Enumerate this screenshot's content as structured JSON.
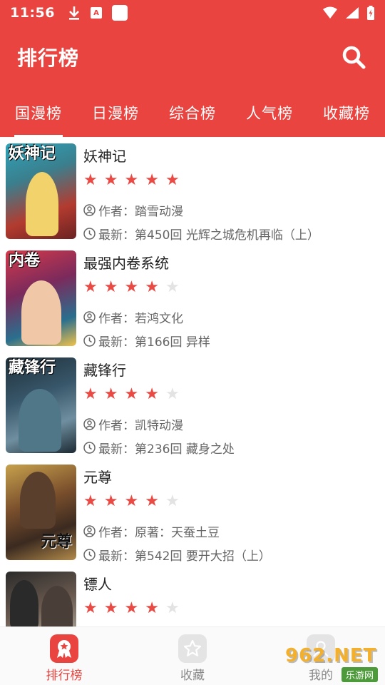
{
  "status_bar": {
    "time": "11:56",
    "badge_letter": "A"
  },
  "app_bar": {
    "title": "排行榜",
    "search_icon": "search-icon"
  },
  "tabs": [
    {
      "label": "国漫榜",
      "active": true
    },
    {
      "label": "日漫榜",
      "active": false
    },
    {
      "label": "综合榜",
      "active": false
    },
    {
      "label": "人气榜",
      "active": false
    },
    {
      "label": "收藏榜",
      "active": false
    }
  ],
  "list": {
    "items": [
      {
        "title": "妖神记",
        "rating": 5,
        "author_label": "作者：踏雪动漫",
        "latest_label": "最新：第450回 光辉之城危机再临（上）",
        "cover_text": "妖神记"
      },
      {
        "title": "最强内卷系统",
        "rating": 4,
        "author_label": "作者：若鸿文化",
        "latest_label": "最新：第166回 异样",
        "cover_text": "内卷"
      },
      {
        "title": "藏锋行",
        "rating": 4,
        "author_label": "作者：凯特动漫",
        "latest_label": "最新：第236回 藏身之处",
        "cover_text": "藏锋行"
      },
      {
        "title": "元尊",
        "rating": 4,
        "author_label": "作者：原著：天蚕土豆",
        "latest_label": "最新：第542回 要开大招（上）",
        "cover_text": "元尊"
      },
      {
        "title": "镖人",
        "rating": 4,
        "author_label": "",
        "latest_label": "",
        "cover_text": ""
      }
    ]
  },
  "bottom_nav": [
    {
      "label": "排行榜",
      "icon": "ranking-icon",
      "active": true
    },
    {
      "label": "收藏",
      "icon": "star-icon",
      "active": false
    },
    {
      "label": "我的",
      "icon": "user-icon",
      "active": false
    }
  ],
  "watermark": {
    "main": "962.NET",
    "sub": "乐游网"
  },
  "colors": {
    "primary": "#e9443f",
    "star_on": "#ea4a44",
    "star_off": "#e3e3e3"
  }
}
